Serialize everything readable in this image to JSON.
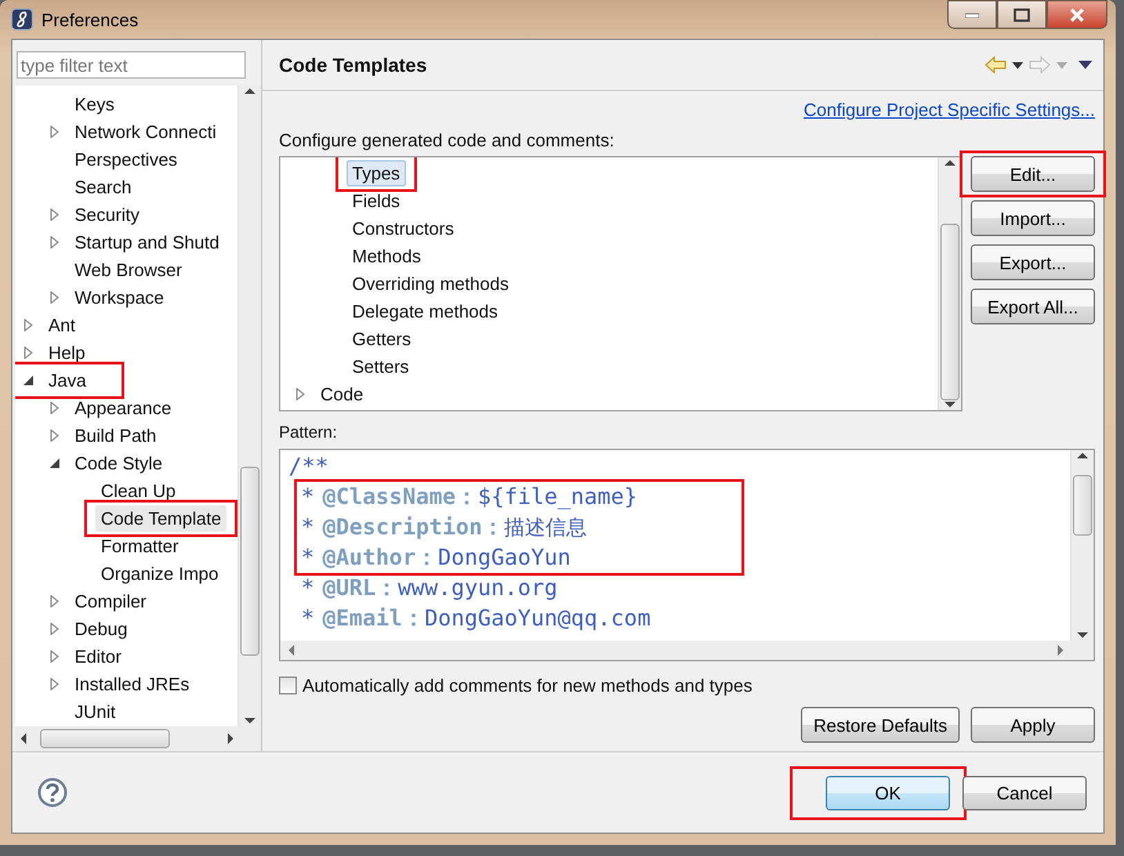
{
  "window": {
    "title": "Preferences"
  },
  "filter": {
    "placeholder": "type filter text"
  },
  "tree": [
    {
      "children": [
        {
          "label": "Keys",
          "selected": false
        },
        {
          "label": "Network Connecti",
          "expanded": false,
          "selected": false
        },
        {
          "label": "Perspectives",
          "selected": false
        },
        {
          "label": "Search",
          "selected": false
        },
        {
          "label": "Security",
          "expanded": false,
          "selected": false
        },
        {
          "label": "Startup and Shutd",
          "expanded": false,
          "selected": false
        },
        {
          "label": "Web Browser",
          "selected": false
        },
        {
          "label": "Workspace",
          "expanded": false,
          "selected": false
        }
      ]
    },
    {
      "label": "Ant",
      "expanded": false,
      "selected": false
    },
    {
      "label": "Help",
      "expanded": false,
      "selected": false
    },
    {
      "label": "Java",
      "expanded": true,
      "selected": false,
      "annotated": true,
      "children": [
        {
          "label": "Appearance",
          "expanded": false,
          "selected": false
        },
        {
          "label": "Build Path",
          "expanded": false,
          "selected": false
        },
        {
          "label": "Code Style",
          "expanded": true,
          "selected": false,
          "children": [
            {
              "label": "Clean Up",
              "selected": false
            },
            {
              "label": "Code Template",
              "selected": true,
              "annotated": true
            },
            {
              "label": "Formatter",
              "selected": false
            },
            {
              "label": "Organize Impo",
              "selected": false
            }
          ]
        },
        {
          "label": "Compiler",
          "expanded": false,
          "selected": false
        },
        {
          "label": "Debug",
          "expanded": false,
          "selected": false
        },
        {
          "label": "Editor",
          "expanded": false,
          "selected": false
        },
        {
          "label": "Installed JREs",
          "expanded": false,
          "selected": false
        },
        {
          "label": "JUnit",
          "selected": false
        }
      ]
    }
  ],
  "page": {
    "title": "Code Templates",
    "link": "Configure Project Specific Settings...",
    "intro": "Configure generated code and comments:"
  },
  "templates": [
    {
      "children": [
        {
          "label": "Types",
          "selected": true,
          "annotated": true
        },
        {
          "label": "Fields",
          "selected": false
        },
        {
          "label": "Constructors",
          "selected": false
        },
        {
          "label": "Methods",
          "selected": false
        },
        {
          "label": "Overriding methods",
          "selected": false
        },
        {
          "label": "Delegate methods",
          "selected": false
        },
        {
          "label": "Getters",
          "selected": false
        },
        {
          "label": "Setters",
          "selected": false
        }
      ]
    },
    {
      "label": "Code",
      "expanded": false,
      "selected": false
    }
  ],
  "side_buttons": [
    {
      "label": "Edit...",
      "annotated": true
    },
    {
      "label": "Import...",
      "annotated": false
    },
    {
      "label": "Export...",
      "annotated": false
    },
    {
      "label": "Export All...",
      "annotated": false
    }
  ],
  "pattern": {
    "label": "Pattern:",
    "lines": [
      {
        "text": "/**",
        "annotated": false
      },
      {
        "marker": "*",
        "tag": "@ClassName：",
        "value": "${file_name}",
        "annotated": true
      },
      {
        "marker": "*",
        "tag": "@Description：",
        "value": "描述信息",
        "annotated": true
      },
      {
        "marker": "*",
        "tag": "@Author：",
        "value": "DongGaoYun",
        "annotated": true
      },
      {
        "marker": "*",
        "tag": "@URL：",
        "value": "www.gyun.org",
        "annotated": false
      },
      {
        "marker": "*",
        "tag": "@Email：",
        "value": "DongGaoYun@qq.com",
        "annotated": false
      }
    ]
  },
  "auto_comments": {
    "label": "Automatically add comments for new methods and types",
    "checked": false
  },
  "page_buttons": [
    "Restore Defaults",
    "Apply"
  ],
  "dialog_buttons": [
    {
      "label": "OK",
      "default": true,
      "annotated": true
    },
    {
      "label": "Cancel",
      "default": false,
      "annotated": false
    }
  ]
}
